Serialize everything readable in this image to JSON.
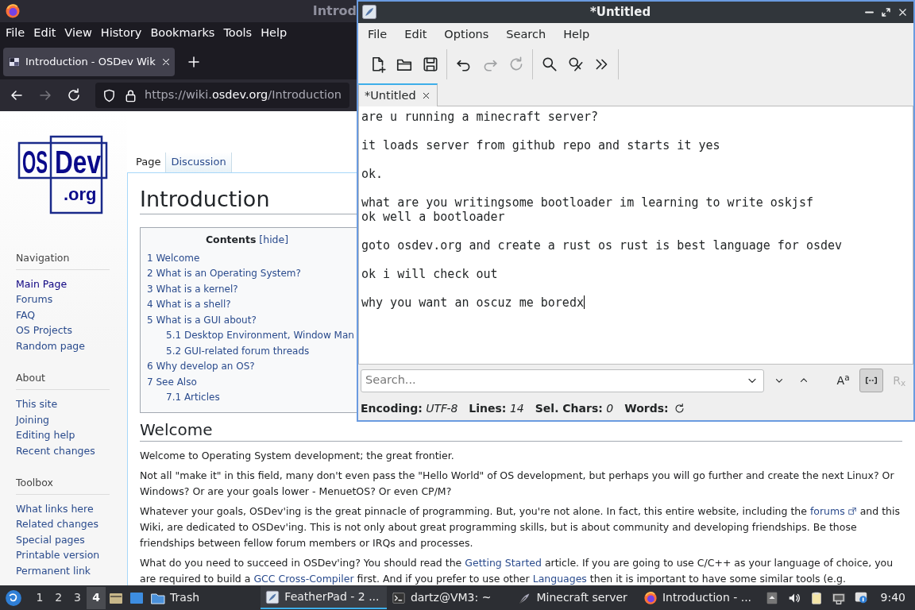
{
  "browser": {
    "title": "Introd",
    "menu": [
      "File",
      "Edit",
      "View",
      "History",
      "Bookmarks",
      "Tools",
      "Help"
    ],
    "tabs": [
      {
        "label": "Introduction - OSDev Wik",
        "selected": true
      }
    ],
    "nav_buttons": [
      {
        "kind": "back",
        "disabled": false
      },
      {
        "kind": "forward",
        "disabled": true
      },
      {
        "kind": "reload",
        "disabled": false
      }
    ],
    "url": {
      "prefix": "https://wiki.",
      "domain": "osdev.org",
      "path": "/Introduction"
    }
  },
  "wiki": {
    "logo": {
      "line_1": "OS",
      "line_2": "Dev",
      "line_3": ".org"
    },
    "sidebar": [
      {
        "heading": "Navigation",
        "items": [
          {
            "label": "Main Page",
            "visited": true
          },
          {
            "label": "Forums",
            "visited": false
          },
          {
            "label": "FAQ",
            "visited": false
          },
          {
            "label": "OS Projects",
            "visited": false
          },
          {
            "label": "Random page",
            "visited": false
          }
        ]
      },
      {
        "heading": "About",
        "items": [
          {
            "label": "This site",
            "visited": false
          },
          {
            "label": "Joining",
            "visited": false
          },
          {
            "label": "Editing help",
            "visited": false
          },
          {
            "label": "Recent changes",
            "visited": false
          }
        ]
      },
      {
        "heading": "Toolbox",
        "items": [
          {
            "label": "What links here",
            "visited": false
          },
          {
            "label": "Related changes",
            "visited": false
          },
          {
            "label": "Special pages",
            "visited": false
          },
          {
            "label": "Printable version",
            "visited": false
          },
          {
            "label": "Permanent link",
            "visited": false
          }
        ]
      }
    ],
    "page_tabs": [
      {
        "label": "Page",
        "selected": true
      },
      {
        "label": "Discussion",
        "selected": false
      }
    ],
    "title": "Introduction",
    "toc": {
      "title": "Contents",
      "toggle": "[hide]",
      "items": [
        {
          "label": "1 Welcome"
        },
        {
          "label": "2 What is an Operating System?"
        },
        {
          "label": "3 What is a kernel?"
        },
        {
          "label": "4 What is a shell?"
        },
        {
          "label": "5 What is a GUI about?",
          "children": [
            {
              "label": "5.1 Desktop Environment, Window Man"
            },
            {
              "label": "5.2 GUI-related forum threads"
            }
          ]
        },
        {
          "label": "6 Why develop an OS?"
        },
        {
          "label": "7 See Also",
          "children": [
            {
              "label": "7.1 Articles"
            }
          ]
        }
      ]
    },
    "section_heading": "Welcome",
    "paragraphs": [
      [
        {
          "kind": "text",
          "text": "Welcome to Operating System development; the great frontier."
        }
      ],
      [
        {
          "kind": "text",
          "text": "Not all \"make it\" in this field, many don't even pass the \"Hello World\" of OS development, but perhaps you will go further and create the next Linux? Or Windows? Or are your goals lower - MenuetOS? Or even CP/M?"
        }
      ],
      [
        {
          "kind": "text",
          "text": "Whatever your goals, OSDev'ing is the great pinnacle of programming. But, you're not alone. In fact, this entire website, including the "
        },
        {
          "kind": "external_link",
          "text": "forums"
        },
        {
          "kind": "text",
          "text": " and this Wiki, are dedicated to OSDev'ing. This is not only about great programming skills, but is about community and developing friendships. Be those friendships between fellow forum members or IRQs and processes."
        }
      ],
      [
        {
          "kind": "text",
          "text": "What do you need to succeed in OSDev'ing? You should read the "
        },
        {
          "kind": "link",
          "text": "Getting Started"
        },
        {
          "kind": "text",
          "text": " article. If you are going to use C/C++ as your language of choice, you are required to build a "
        },
        {
          "kind": "link",
          "text": "GCC Cross-Compiler"
        },
        {
          "kind": "text",
          "text": " first. And if you prefer to use other "
        },
        {
          "kind": "link",
          "text": "Languages"
        },
        {
          "kind": "text",
          "text": " then it is important to have some similar tools (e.g."
        }
      ]
    ]
  },
  "editor_window": {
    "title": "*Untitled",
    "menu": [
      "File",
      "Edit",
      "Options",
      "Search",
      "Help"
    ],
    "toolbar": [
      [
        {
          "kind": "new",
          "disabled": false
        },
        {
          "kind": "open",
          "disabled": false
        },
        {
          "kind": "save",
          "disabled": false
        }
      ],
      [
        {
          "kind": "undo",
          "disabled": false
        },
        {
          "kind": "redo",
          "disabled": true
        },
        {
          "kind": "reload",
          "disabled": true
        }
      ],
      [
        {
          "kind": "find",
          "disabled": false
        },
        {
          "kind": "replace",
          "disabled": false
        },
        {
          "kind": "more",
          "disabled": false
        }
      ]
    ],
    "tabs": [
      {
        "label": "*Untitled",
        "selected": true
      }
    ],
    "text": "are u running a minecraft server?\n\nit loads server from github repo and starts it yes\n\nok.\n\nwhat are you writingsome bootloader im learning to write oskjsf\nok well a bootloader\n\ngoto osdev.org and create a rust os rust is best language for osdev\n\nok i will check out\n\nwhy you want an oscuz me boredx",
    "search": {
      "placeholder": "Search...",
      "toggles": [
        {
          "kind": "case",
          "label": "A$^{a}$",
          "pressed": false,
          "disabled": false
        },
        {
          "kind": "word",
          "pressed": true,
          "disabled": false
        },
        {
          "kind": "regex",
          "label": "R$_{x}$",
          "pressed": false,
          "disabled": true
        }
      ]
    },
    "status": [
      "**Encoding:** *UTF-8*",
      "**Lines:** *14*",
      "**Sel. Chars:** *0*",
      "**Words:**"
    ]
  },
  "taskbar": {
    "workspaces": [
      {
        "label": "1",
        "selected": false
      },
      {
        "label": "2",
        "selected": false
      },
      {
        "label": "3",
        "selected": false
      },
      {
        "label": "4",
        "selected": true
      }
    ],
    "launchers": [
      {
        "kind": "files"
      },
      {
        "kind": "desktop"
      },
      {
        "kind": "folder",
        "label": "Trash"
      }
    ],
    "tasks": [
      {
        "kind": "featherpad",
        "label": "FeatherPad - 2 ...",
        "selected": true
      },
      {
        "kind": "terminal",
        "label": "dartz@VM3: ~",
        "selected": false
      },
      {
        "kind": "feather",
        "label": "Minecraft server",
        "selected": false
      },
      {
        "kind": "firefox",
        "label": "Introduction - ...",
        "selected": false
      }
    ],
    "tray": [
      {
        "kind": "up"
      },
      {
        "kind": "volume"
      },
      {
        "kind": "clipboard"
      },
      {
        "kind": "network"
      },
      {
        "kind": "info"
      }
    ],
    "clock": "9:40"
  }
}
